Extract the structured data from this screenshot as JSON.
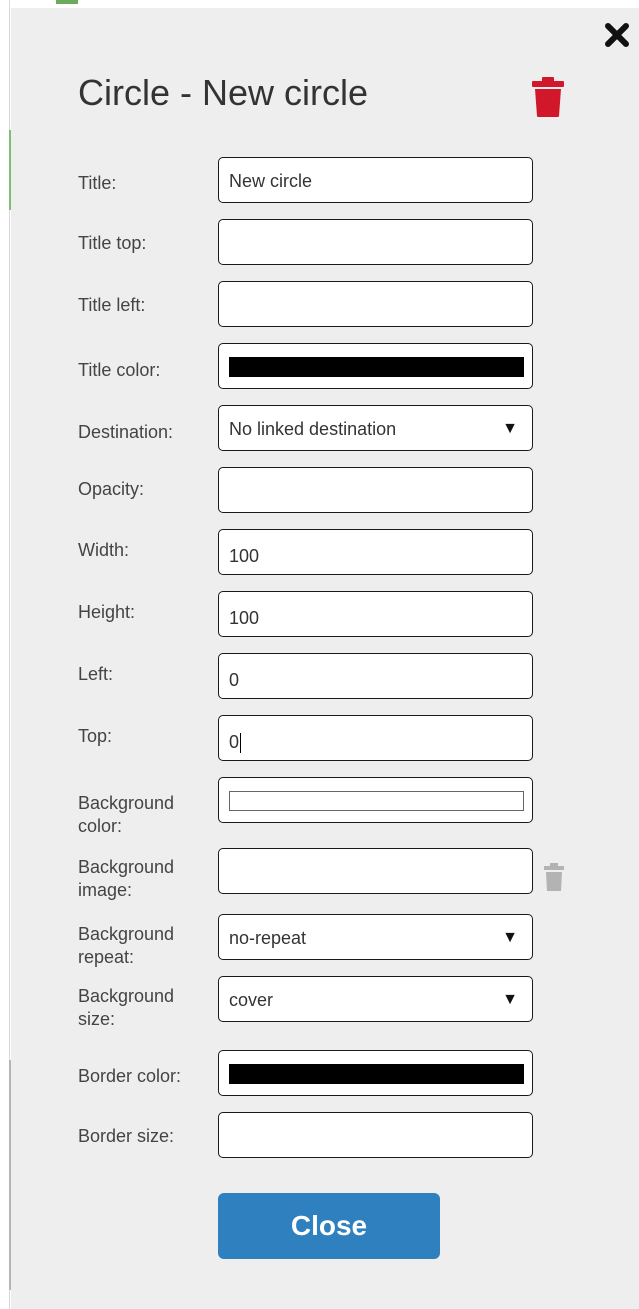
{
  "dialog": {
    "title": "Circle - New circle",
    "close_button_label": "Close"
  },
  "fields": [
    {
      "label": "Title:",
      "type": "text",
      "value": "New circle"
    },
    {
      "label": "Title top:",
      "type": "text",
      "value": ""
    },
    {
      "label": "Title left:",
      "type": "text",
      "value": ""
    },
    {
      "label": "Title color:",
      "type": "color",
      "value": "#000000"
    },
    {
      "label": "Destination:",
      "type": "select",
      "value": "No linked destination"
    },
    {
      "label": "Opacity:",
      "type": "text",
      "value": ""
    },
    {
      "label": "Width:",
      "type": "text",
      "value": "100"
    },
    {
      "label": "Height:",
      "type": "text",
      "value": "100"
    },
    {
      "label": "Left:",
      "type": "text",
      "value": "0"
    },
    {
      "label": "Top:",
      "type": "text",
      "value": "0"
    },
    {
      "label": "Background color:",
      "type": "color",
      "value": "#ffffff"
    },
    {
      "label": "Background image:",
      "type": "text",
      "value": ""
    },
    {
      "label": "Background repeat:",
      "type": "select",
      "value": "no-repeat"
    },
    {
      "label": "Background size:",
      "type": "select",
      "value": "cover"
    },
    {
      "label": "Border color:",
      "type": "color",
      "value": "#000000"
    },
    {
      "label": "Border size:",
      "type": "text",
      "value": ""
    }
  ],
  "icons": {
    "close": "close-x-icon",
    "delete": "trash-icon",
    "clear_image": "trash-icon",
    "dropdown": "caret-down-icon"
  },
  "colors": {
    "accent": "#2f80be",
    "danger": "#d0182a",
    "panel_bg": "#eeeeee"
  }
}
